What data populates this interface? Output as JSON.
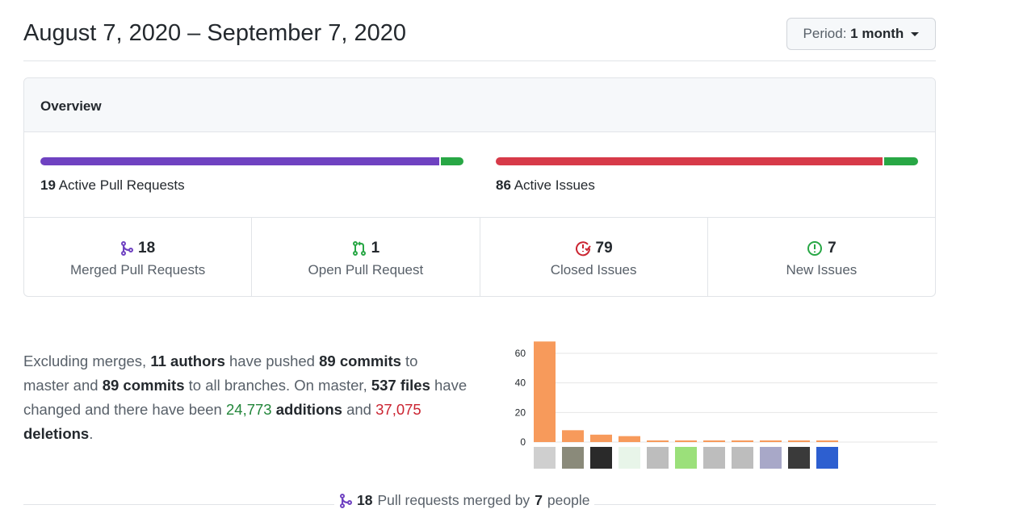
{
  "header": {
    "title": "August 7, 2020 – September 7, 2020",
    "period_label": "Period:",
    "period_value": "1 month"
  },
  "overview": {
    "title": "Overview",
    "pull_requests": {
      "count": "19",
      "label": "Active Pull Requests",
      "merged_fraction": 0.947,
      "open_fraction": 0.053
    },
    "issues": {
      "count": "86",
      "label": "Active Issues",
      "closed_fraction": 0.919,
      "new_fraction": 0.081
    },
    "stats": [
      {
        "icon": "git-merge-icon",
        "value": "18",
        "label": "Merged Pull Requests",
        "color": "#6f42c1"
      },
      {
        "icon": "git-pull-request-icon",
        "value": "1",
        "label": "Open Pull Request",
        "color": "#28a745"
      },
      {
        "icon": "issue-closed-icon",
        "value": "79",
        "label": "Closed Issues",
        "color": "#cb2431"
      },
      {
        "icon": "issue-opened-icon",
        "value": "7",
        "label": "New Issues",
        "color": "#28a745"
      }
    ]
  },
  "summary": {
    "t1": "Excluding merges, ",
    "authors": "11 authors",
    "t2": " have pushed ",
    "commits_master": "89 commits",
    "t3": " to master and ",
    "commits_all": "89 commits",
    "t4": " to all branches. On master, ",
    "files": "537 files",
    "t5": " have changed and there have been ",
    "additions_num": "24,773",
    "additions_word": "additions",
    "t6": " and ",
    "deletions_num": "37,075",
    "deletions_word": "deletions",
    "t7": "."
  },
  "chart_data": {
    "type": "bar",
    "ylim": [
      0,
      70
    ],
    "yticks": [
      "0",
      "20",
      "40",
      "60"
    ],
    "values": [
      68,
      8,
      5,
      4,
      1,
      1,
      1,
      1,
      1,
      1,
      1
    ],
    "bar_color": "#f79a5b",
    "avatar_colors": [
      "#cfcfcf",
      "#8a8a7a",
      "#2a2a2a",
      "#e8f5e9",
      "#bdbdbd",
      "#9be07a",
      "#bdbdbd",
      "#bdbdbd",
      "#a8a8c8",
      "#3a3a3a",
      "#2d5fd0"
    ]
  },
  "footer": {
    "count": "18",
    "t1": "Pull requests merged by",
    "people": "7",
    "t2": "people"
  },
  "colors": {
    "purple": "#6f42c1",
    "green": "#28a745",
    "red": "#d73a49"
  }
}
